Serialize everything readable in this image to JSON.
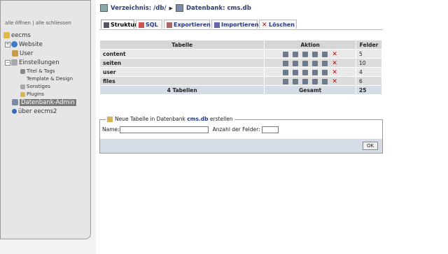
{
  "sidebar": {
    "open_all": "alle öffnen",
    "divider": "|",
    "close_all": "alle schliessen",
    "root": "eecms",
    "items": [
      {
        "label": "Website"
      },
      {
        "label": "User"
      },
      {
        "label": "Einstellungen"
      },
      {
        "label": "Titel & Tags"
      },
      {
        "label": "Template & Design"
      },
      {
        "label": "Sonstiges"
      },
      {
        "label": "Plugins"
      },
      {
        "label": "Datenbank-Admin"
      },
      {
        "label": "über eecms2"
      }
    ]
  },
  "breadcrumb": {
    "dir_label": "Verzeichnis: /db/",
    "db_label": "Datenbank: cms.db"
  },
  "tabs": [
    {
      "label": "Struktur"
    },
    {
      "label": "SQL"
    },
    {
      "label": "Exportieren"
    },
    {
      "label": "Importieren"
    },
    {
      "label": "Löschen"
    }
  ],
  "table": {
    "headers": {
      "table": "Tabelle",
      "action": "Aktion",
      "fields": "Felder"
    },
    "rows": [
      {
        "name": "content",
        "fields": "5"
      },
      {
        "name": "seiten",
        "fields": "10"
      },
      {
        "name": "user",
        "fields": "4"
      },
      {
        "name": "files",
        "fields": "6"
      }
    ],
    "footer": {
      "count": "4 Tabellen",
      "total_label": "Gesamt",
      "total": "25"
    }
  },
  "new_table": {
    "title_prefix": "Neue Tabelle in Datenbank",
    "db_name": "cms.db",
    "title_suffix": "erstellen",
    "name_label": "Name:",
    "name_value": "",
    "fields_label": "Anzahl der Felder:",
    "fields_value": "",
    "ok_label": "OK"
  }
}
